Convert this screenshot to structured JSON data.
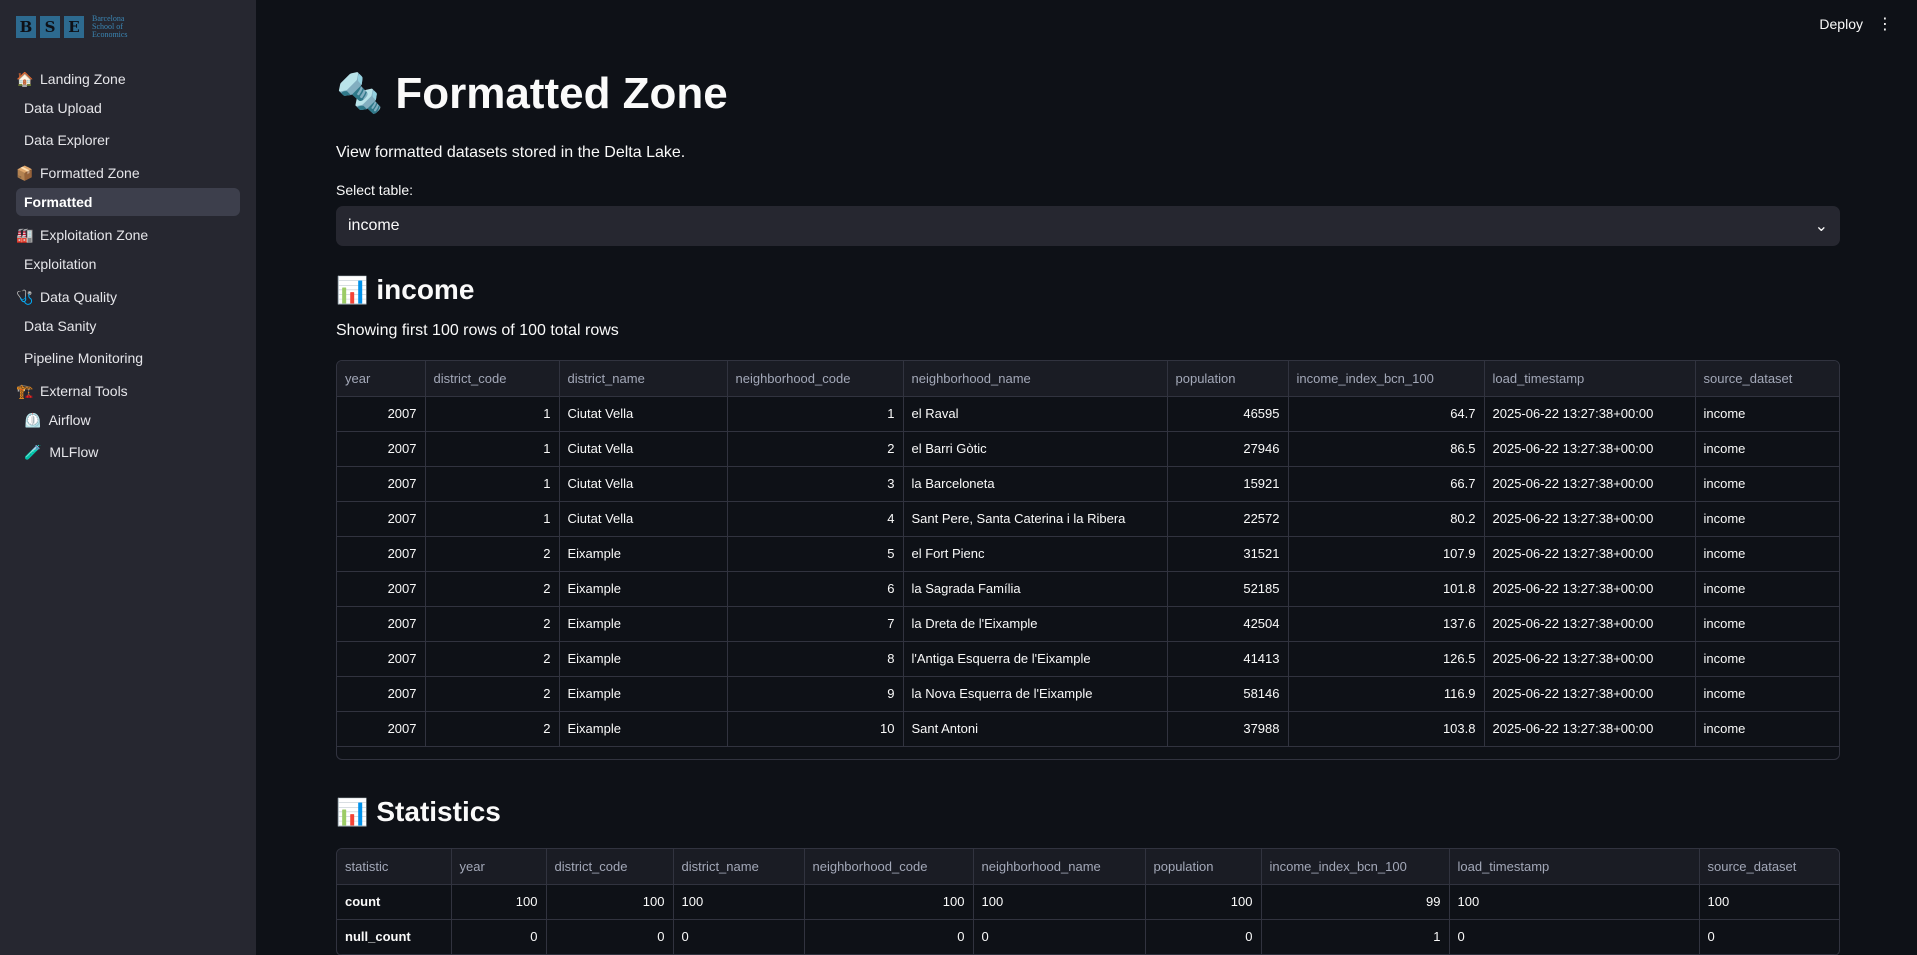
{
  "logo": {
    "letters": [
      "B",
      "S",
      "E"
    ],
    "text_lines": [
      "Barcelona",
      "School of",
      "Economics"
    ]
  },
  "sidebar": {
    "sections": [
      {
        "emoji": "🏠",
        "label": "Landing Zone",
        "items": [
          {
            "label": "Data Upload"
          },
          {
            "label": "Data Explorer"
          }
        ]
      },
      {
        "emoji": "📦",
        "label": "Formatted Zone",
        "items": [
          {
            "label": "Formatted",
            "active": true
          }
        ]
      },
      {
        "emoji": "🏭",
        "label": "Exploitation Zone",
        "items": [
          {
            "label": "Exploitation"
          }
        ]
      },
      {
        "emoji": "🩺",
        "label": "Data Quality",
        "items": [
          {
            "label": "Data Sanity"
          },
          {
            "label": "Pipeline Monitoring"
          }
        ]
      },
      {
        "emoji": "🏗️",
        "label": "External Tools",
        "items": [
          {
            "emoji": "⏲️",
            "label": "Airflow"
          },
          {
            "emoji": "🧪",
            "label": "MLFlow"
          }
        ]
      }
    ]
  },
  "header": {
    "deploy_label": "Deploy",
    "menu_glyph": "⋮"
  },
  "page": {
    "title_emoji": "🔩",
    "title": "Formatted Zone",
    "subtitle": "View formatted datasets stored in the Delta Lake.",
    "select_label": "Select table:",
    "select_value": "income",
    "chevron_glyph": "⌄"
  },
  "table_section": {
    "emoji": "📊",
    "title": "income",
    "rows_info": "Showing first 100 rows of 100 total rows",
    "columns": [
      "year",
      "district_code",
      "district_name",
      "neighborhood_code",
      "neighborhood_name",
      "population",
      "income_index_bcn_100",
      "load_timestamp",
      "source_dataset"
    ],
    "rows": [
      [
        "2007",
        "1",
        "Ciutat Vella",
        "1",
        "el Raval",
        "46595",
        "64.7",
        "2025-06-22 13:27:38+00:00",
        "income"
      ],
      [
        "2007",
        "1",
        "Ciutat Vella",
        "2",
        "el Barri Gòtic",
        "27946",
        "86.5",
        "2025-06-22 13:27:38+00:00",
        "income"
      ],
      [
        "2007",
        "1",
        "Ciutat Vella",
        "3",
        "la Barceloneta",
        "15921",
        "66.7",
        "2025-06-22 13:27:38+00:00",
        "income"
      ],
      [
        "2007",
        "1",
        "Ciutat Vella",
        "4",
        "Sant Pere, Santa Caterina i la Ribera",
        "22572",
        "80.2",
        "2025-06-22 13:27:38+00:00",
        "income"
      ],
      [
        "2007",
        "2",
        "Eixample",
        "5",
        "el Fort Pienc",
        "31521",
        "107.9",
        "2025-06-22 13:27:38+00:00",
        "income"
      ],
      [
        "2007",
        "2",
        "Eixample",
        "6",
        "la Sagrada Família",
        "52185",
        "101.8",
        "2025-06-22 13:27:38+00:00",
        "income"
      ],
      [
        "2007",
        "2",
        "Eixample",
        "7",
        "la Dreta de l'Eixample",
        "42504",
        "137.6",
        "2025-06-22 13:27:38+00:00",
        "income"
      ],
      [
        "2007",
        "2",
        "Eixample",
        "8",
        "l'Antiga Esquerra de l'Eixample",
        "41413",
        "126.5",
        "2025-06-22 13:27:38+00:00",
        "income"
      ],
      [
        "2007",
        "2",
        "Eixample",
        "9",
        "la Nova Esquerra de l'Eixample",
        "58146",
        "116.9",
        "2025-06-22 13:27:38+00:00",
        "income"
      ],
      [
        "2007",
        "2",
        "Eixample",
        "10",
        "Sant Antoni",
        "37988",
        "103.8",
        "2025-06-22 13:27:38+00:00",
        "income"
      ]
    ]
  },
  "stats_section": {
    "emoji": "📊",
    "title": "Statistics",
    "columns": [
      "statistic",
      "year",
      "district_code",
      "district_name",
      "neighborhood_code",
      "neighborhood_name",
      "population",
      "income_index_bcn_100",
      "load_timestamp",
      "source_dataset"
    ],
    "rows": [
      [
        "count",
        "100",
        "100",
        "100",
        "100",
        "100",
        "100",
        "99",
        "100",
        "100"
      ],
      [
        "null_count",
        "0",
        "0",
        "0",
        "0",
        "0",
        "0",
        "1",
        "0",
        "0"
      ]
    ]
  }
}
